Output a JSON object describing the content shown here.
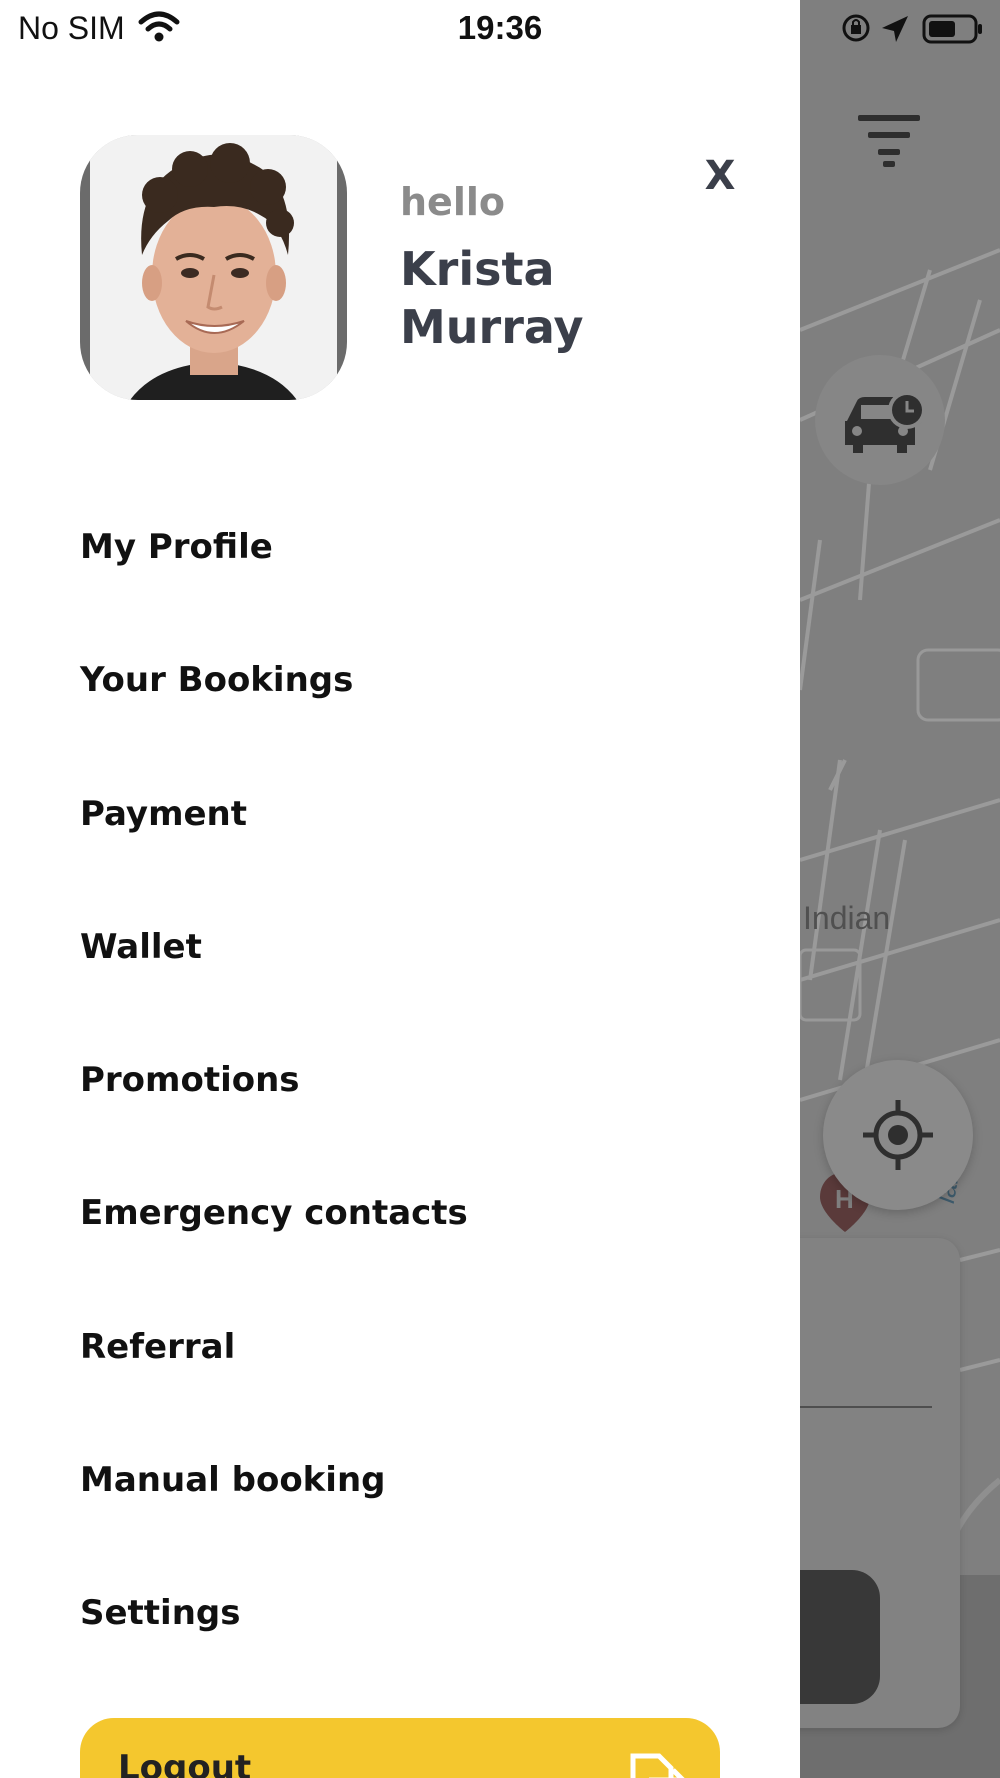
{
  "status_bar": {
    "carrier": "No SIM",
    "time": "19:36"
  },
  "drawer": {
    "greeting": "hello",
    "user_name": "Krista Murray",
    "close_label": "X",
    "menu_items": [
      "My Profile",
      "Your Bookings",
      "Payment",
      "Wallet",
      "Promotions",
      "Emergency contacts",
      "Referral",
      "Manual booking",
      "Settings"
    ],
    "logout_label": "Logout"
  },
  "map": {
    "place_label": "Indian",
    "road_label": "lai"
  },
  "icons": {
    "filter": "filter-icon",
    "schedule_ride": "car-clock-icon",
    "locate": "crosshair-icon",
    "poi": "hospital-marker-icon",
    "logout": "logout-icon"
  },
  "colors": {
    "accent": "#f4c72e",
    "drawer_background": "#ffffff",
    "name_text": "#3b3f4a",
    "greeting_text": "#8b8b8b",
    "overlay": "#7f7f7f"
  }
}
